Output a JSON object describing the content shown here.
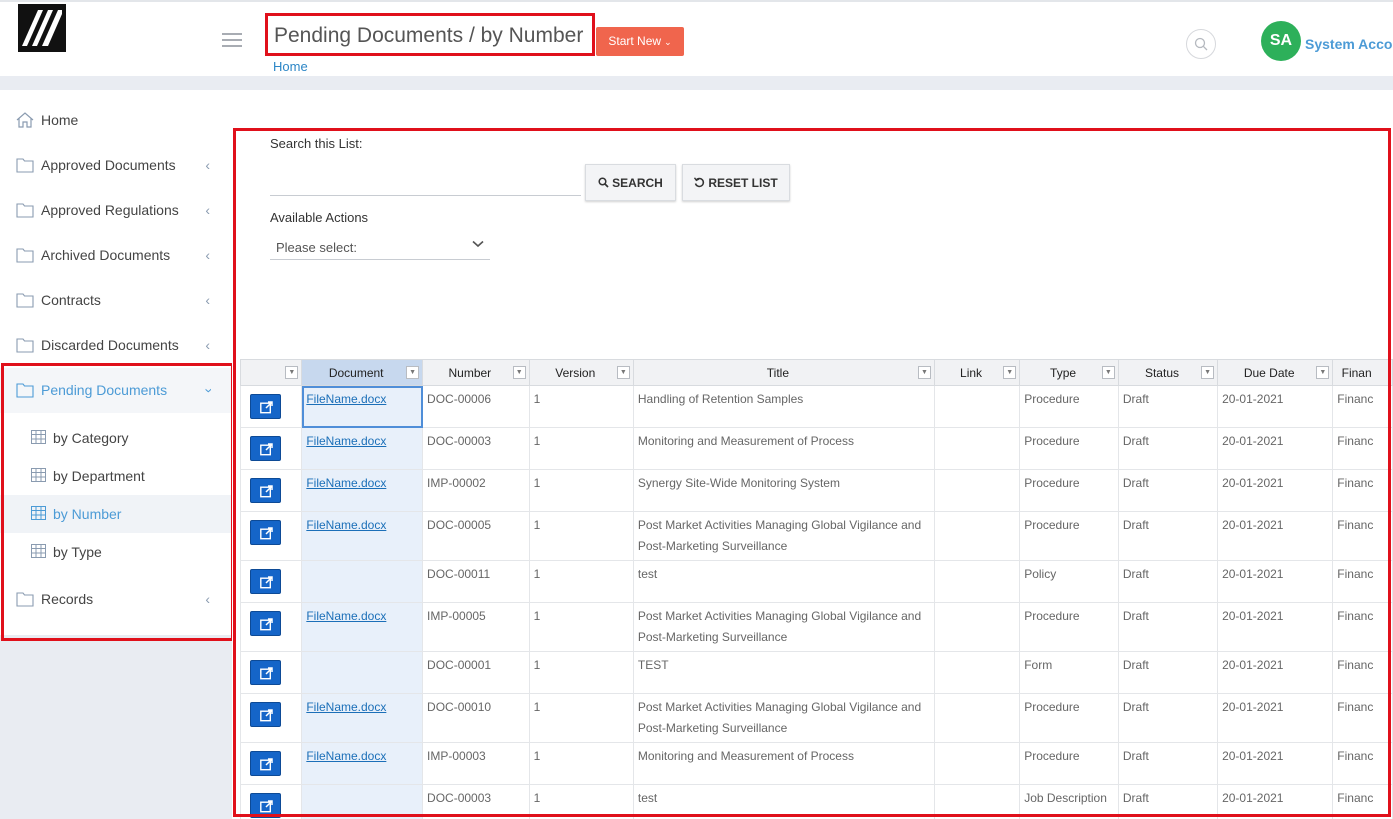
{
  "header": {
    "title": "Pending Documents / by Number",
    "start_new": "Start New",
    "breadcrumb": "Home",
    "user_initials": "SA",
    "user_name": "System Acco"
  },
  "sidebar": {
    "items": [
      {
        "label": "Home",
        "icon": "home-icon"
      },
      {
        "label": "Approved Documents",
        "icon": "folder-icon"
      },
      {
        "label": "Approved Regulations",
        "icon": "folder-icon"
      },
      {
        "label": "Archived Documents",
        "icon": "folder-icon"
      },
      {
        "label": "Contracts",
        "icon": "folder-icon"
      },
      {
        "label": "Discarded Documents",
        "icon": "folder-icon"
      },
      {
        "label": "Pending Documents",
        "icon": "folder-icon"
      },
      {
        "label": "Records",
        "icon": "folder-icon"
      }
    ],
    "sub_items": [
      {
        "label": "by Category",
        "icon": "table-icon"
      },
      {
        "label": "by Department",
        "icon": "table-icon"
      },
      {
        "label": "by Number",
        "icon": "table-icon"
      },
      {
        "label": "by Type",
        "icon": "table-icon"
      }
    ]
  },
  "search": {
    "label": "Search this List:",
    "value": "",
    "search_button": "SEARCH",
    "reset_button": "RESET LIST"
  },
  "actions": {
    "label": "Available Actions",
    "selected": "Please select:"
  },
  "table": {
    "columns": [
      "",
      "Document",
      "Number",
      "Version",
      "Title",
      "Link",
      "Type",
      "Status",
      "Due Date",
      "Finan"
    ],
    "rows": [
      {
        "document": "FileName.docx",
        "number": "DOC-00006",
        "version": "1",
        "title": "Handling of Retention Samples",
        "link": "",
        "type": "Procedure",
        "status": "Draft",
        "due": "20-01-2021",
        "extra": "Financ"
      },
      {
        "document": "FileName.docx",
        "number": "DOC-00003",
        "version": "1",
        "title": "Monitoring and Measurement of Process",
        "link": "",
        "type": "Procedure",
        "status": "Draft",
        "due": "20-01-2021",
        "extra": "Financ"
      },
      {
        "document": "FileName.docx",
        "number": "IMP-00002",
        "version": "1",
        "title": "Synergy Site-Wide Monitoring System",
        "link": "",
        "type": "Procedure",
        "status": "Draft",
        "due": "20-01-2021",
        "extra": "Financ"
      },
      {
        "document": "FileName.docx",
        "number": "DOC-00005",
        "version": "1",
        "title": "Post Market Activities Managing Global Vigilance and Post-Marketing Surveillance",
        "link": "",
        "type": "Procedure",
        "status": "Draft",
        "due": "20-01-2021",
        "extra": "Financ"
      },
      {
        "document": "",
        "number": "DOC-00011",
        "version": "1",
        "title": "test",
        "link": "",
        "type": "Policy",
        "status": "Draft",
        "due": "20-01-2021",
        "extra": "Financ"
      },
      {
        "document": "FileName.docx",
        "number": "IMP-00005",
        "version": "1",
        "title": "Post Market Activities Managing Global Vigilance and Post-Marketing Surveillance",
        "link": "",
        "type": "Procedure",
        "status": "Draft",
        "due": "20-01-2021",
        "extra": "Financ"
      },
      {
        "document": "",
        "number": "DOC-00001",
        "version": "1",
        "title": "TEST",
        "link": "",
        "type": "Form",
        "status": "Draft",
        "due": "20-01-2021",
        "extra": "Financ"
      },
      {
        "document": "FileName.docx",
        "number": "DOC-00010",
        "version": "1",
        "title": "Post Market Activities Managing Global Vigilance and Post-Marketing Surveillance",
        "link": "",
        "type": "Procedure",
        "status": "Draft",
        "due": "20-01-2021",
        "extra": "Financ"
      },
      {
        "document": "FileName.docx",
        "number": "IMP-00003",
        "version": "1",
        "title": "Monitoring and Measurement of Process",
        "link": "",
        "type": "Procedure",
        "status": "Draft",
        "due": "20-01-2021",
        "extra": "Financ"
      },
      {
        "document": "",
        "number": "DOC-00003",
        "version": "1",
        "title": "test",
        "link": "",
        "type": "Job Description",
        "status": "Draft",
        "due": "20-01-2021",
        "extra": "Financ"
      }
    ]
  },
  "colors": {
    "highlight": "#e0101b",
    "accent": "#4c9bd6",
    "start_new": "#f0654d",
    "avatar": "#2db05a",
    "open_button": "#1565c8"
  }
}
